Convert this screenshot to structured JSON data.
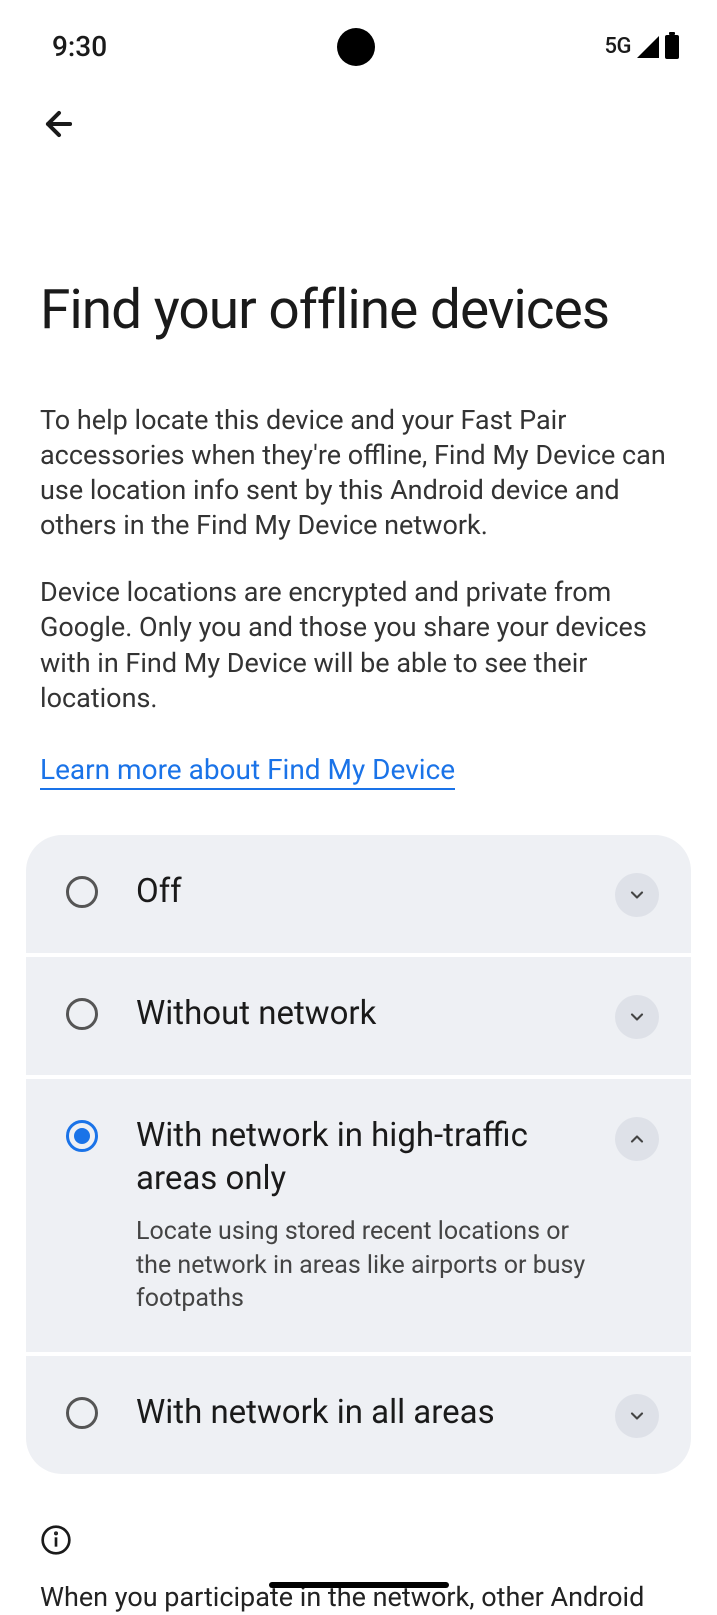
{
  "status": {
    "time": "9:30",
    "network": "5G"
  },
  "page": {
    "title": "Find your offline devices",
    "description1": "To help locate this device and your Fast Pair accessories when they're offline, Find My Device can use location info sent by this Android device and others in the Find My Device network.",
    "description2": "Device locations are encrypted and private from Google. Only you and those you share your devices with in Find My Device will be able to see their locations.",
    "learn_more": "Learn more about Find My Device"
  },
  "options": [
    {
      "label": "Off",
      "selected": false,
      "expanded": false
    },
    {
      "label": "Without network",
      "selected": false,
      "expanded": false
    },
    {
      "label": "With network in high-traffic areas only",
      "description": "Locate using stored recent locations or the network in areas like airports or busy footpaths",
      "selected": true,
      "expanded": true
    },
    {
      "label": "With network in all areas",
      "selected": false,
      "expanded": false
    }
  ],
  "info": {
    "text": "When you participate in the network, other Android"
  }
}
